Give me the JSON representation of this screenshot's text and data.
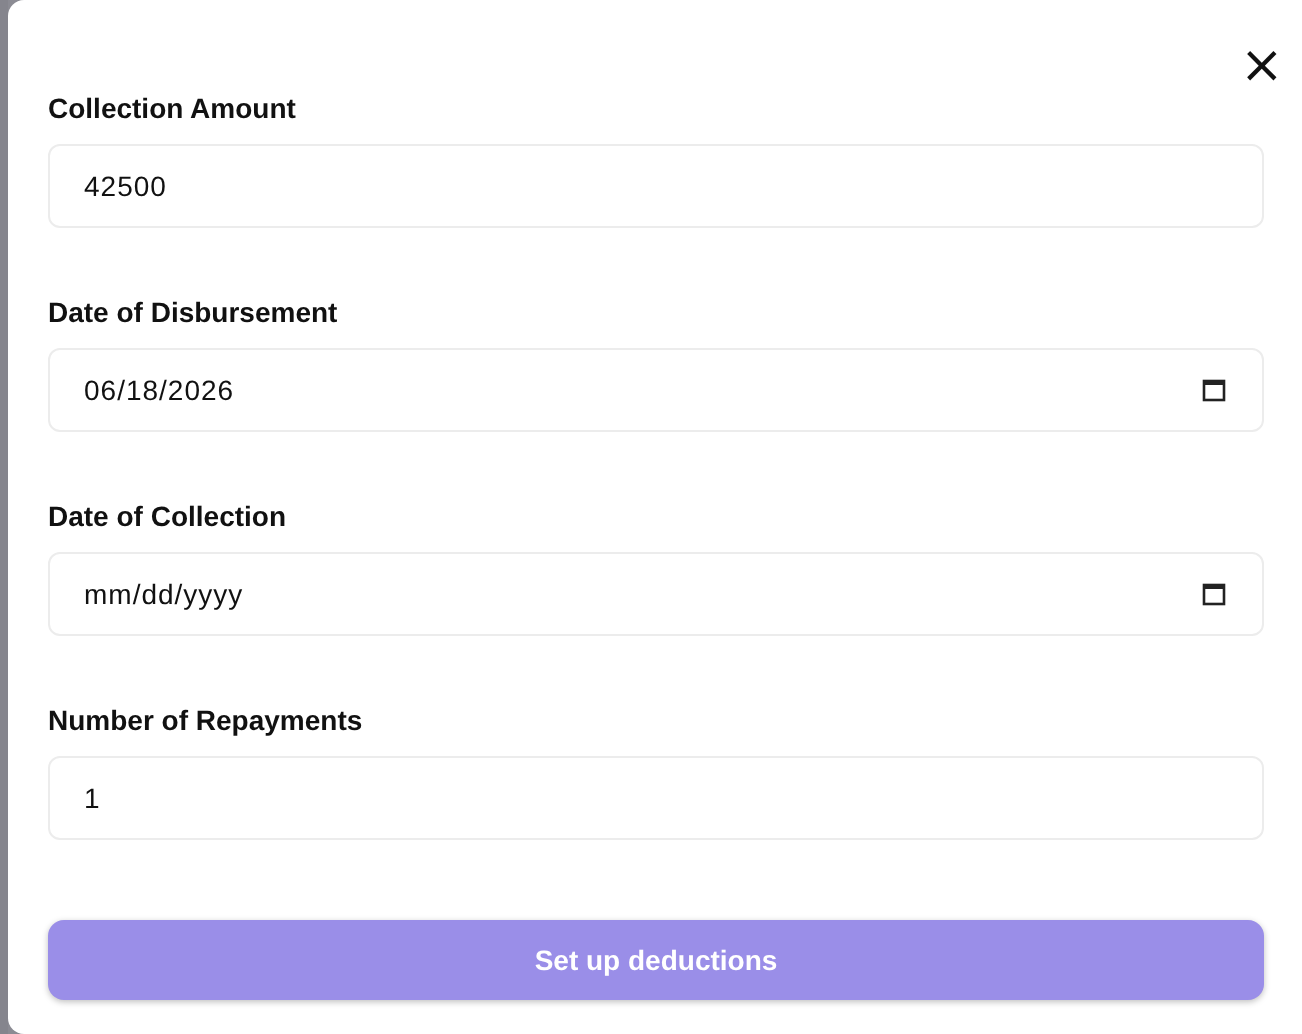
{
  "dialog": {
    "close": "×",
    "fields": [
      {
        "label": "Collection Amount",
        "kind": "text",
        "value": "42500"
      },
      {
        "label": "Date of Disbursement",
        "kind": "date",
        "value": "06/18/2026"
      },
      {
        "label": "Date of Collection",
        "kind": "date",
        "placeholder": "mm/dd/yyyy"
      },
      {
        "label": "Number of Repayments",
        "kind": "text",
        "value": "1"
      }
    ],
    "submit": {
      "label": "Set up deductions",
      "disabled": true
    }
  }
}
